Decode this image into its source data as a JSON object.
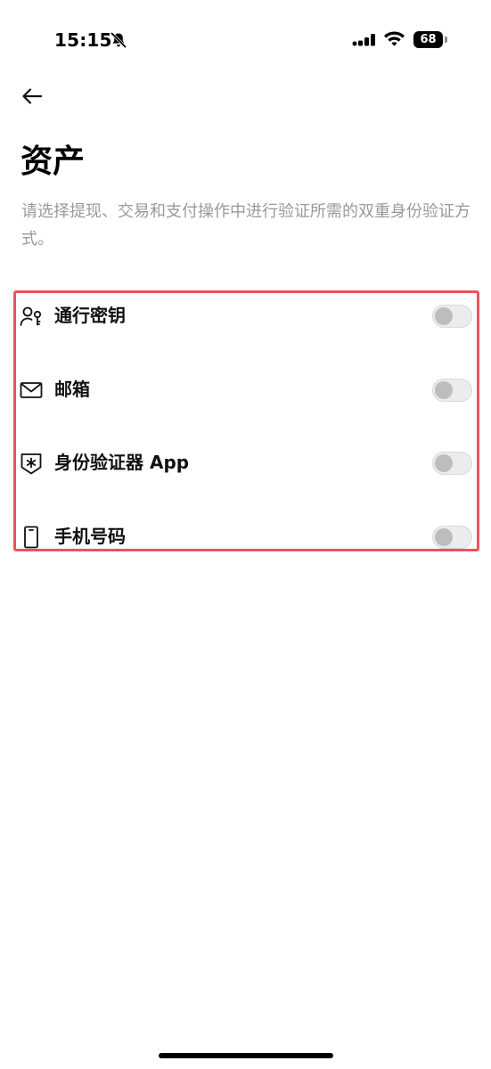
{
  "status_bar": {
    "time": "15:15",
    "battery_level": "68",
    "icons": [
      "bell-off-icon",
      "cellular-signal-icon",
      "wifi-icon",
      "battery-icon"
    ]
  },
  "nav": {
    "back_icon": "arrow-left-icon"
  },
  "page": {
    "title": "资产",
    "description": "请选择提现、交易和支付操作中进行验证所需的双重身份验证方式。"
  },
  "methods": [
    {
      "label": "通行密钥",
      "icon": "passkey-icon",
      "enabled": false
    },
    {
      "label": "邮箱",
      "icon": "mail-icon",
      "enabled": false
    },
    {
      "label": "身份验证器 App",
      "icon": "authenticator-shield-icon",
      "enabled": false
    },
    {
      "label": "手机号码",
      "icon": "mobile-phone-icon",
      "enabled": false
    }
  ],
  "colors": {
    "highlight_border": "#e8545c",
    "description_text": "#9a9a9a",
    "toggle_off_track": "#ececec",
    "toggle_off_knob": "#bdbdbd"
  }
}
